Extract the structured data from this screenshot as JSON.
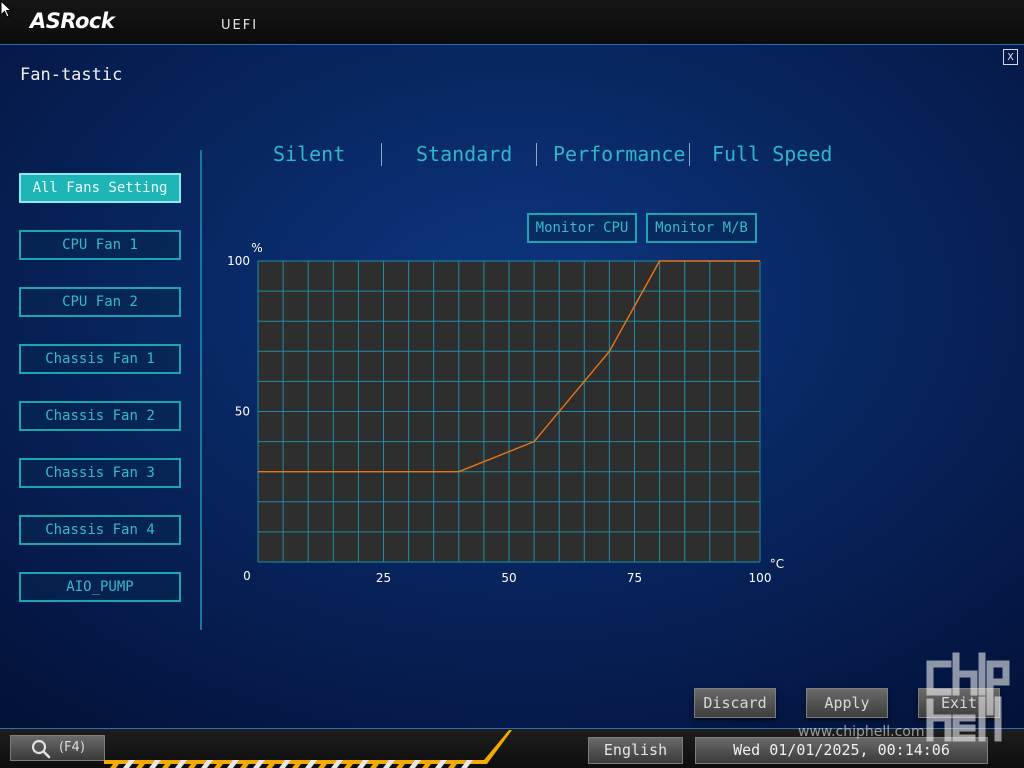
{
  "app": {
    "brand": "ASRock",
    "mode": "UEFI",
    "close_label": "X"
  },
  "page": {
    "title": "Fan-tastic"
  },
  "sidebar": {
    "items": [
      {
        "label": "All Fans Setting",
        "active": true
      },
      {
        "label": "CPU Fan 1",
        "active": false
      },
      {
        "label": "CPU Fan 2",
        "active": false
      },
      {
        "label": "Chassis Fan 1",
        "active": false
      },
      {
        "label": "Chassis Fan 2",
        "active": false
      },
      {
        "label": "Chassis Fan 3",
        "active": false
      },
      {
        "label": "Chassis Fan 4",
        "active": false
      },
      {
        "label": "AIO_PUMP",
        "active": false
      }
    ]
  },
  "presets": [
    "Silent",
    "Standard",
    "Performance",
    "Full Speed"
  ],
  "monitor": {
    "cpu_label": "Monitor CPU",
    "mb_label": "Monitor M/B"
  },
  "chart_data": {
    "type": "line",
    "xlabel": "°C",
    "ylabel": "%",
    "xlim": [
      0,
      100
    ],
    "ylim": [
      0,
      100
    ],
    "x_ticks": [
      25,
      50,
      75,
      100
    ],
    "x_zero_label": "0",
    "y_ticks": [
      100,
      50
    ],
    "grid": true,
    "series": [
      {
        "x": [
          0,
          40,
          55,
          70,
          80,
          100
        ],
        "y": [
          30,
          30,
          40,
          70,
          100,
          100
        ],
        "color": "#e8751a"
      }
    ],
    "colors": {
      "grid": "#1a8fa3",
      "background": "#2e2e2e",
      "line": "#e8751a"
    }
  },
  "actions": {
    "discard_label": "Discard",
    "apply_label": "Apply",
    "exit_label": "Exit"
  },
  "footer": {
    "search_key": "(F4)",
    "language": "English",
    "datetime": "Wed 01/01/2025, 00:14:06",
    "watermark": "www.chiphell.com"
  }
}
